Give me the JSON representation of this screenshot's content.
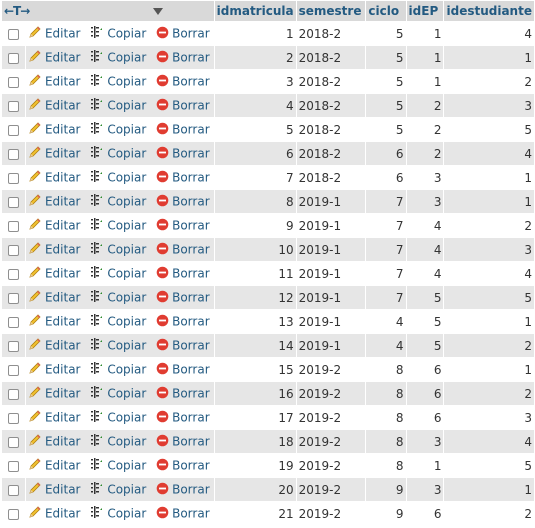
{
  "header": {
    "nav_arrows": "←T→",
    "columns": [
      "idmatricula",
      "semestre",
      "ciclo",
      "idEP",
      "idestudiante"
    ]
  },
  "actions": {
    "edit_label": "Editar",
    "copy_label": "Copiar",
    "delete_label": "Borrar"
  },
  "colors": {
    "link": "#235a81",
    "row_even": "#e6e6e6",
    "header_bg": "#d9d9d9",
    "delete_red": "#e03c31"
  },
  "icons": {
    "edit": "pencil-icon",
    "copy": "copy-icon",
    "delete": "delete-icon"
  },
  "rows": [
    {
      "idmatricula": "1",
      "semestre": "2018-2",
      "ciclo": "5",
      "idEP": "1",
      "idestudiante": "4"
    },
    {
      "idmatricula": "2",
      "semestre": "2018-2",
      "ciclo": "5",
      "idEP": "1",
      "idestudiante": "1"
    },
    {
      "idmatricula": "3",
      "semestre": "2018-2",
      "ciclo": "5",
      "idEP": "1",
      "idestudiante": "2"
    },
    {
      "idmatricula": "4",
      "semestre": "2018-2",
      "ciclo": "5",
      "idEP": "2",
      "idestudiante": "3"
    },
    {
      "idmatricula": "5",
      "semestre": "2018-2",
      "ciclo": "5",
      "idEP": "2",
      "idestudiante": "5"
    },
    {
      "idmatricula": "6",
      "semestre": "2018-2",
      "ciclo": "6",
      "idEP": "2",
      "idestudiante": "4"
    },
    {
      "idmatricula": "7",
      "semestre": "2018-2",
      "ciclo": "6",
      "idEP": "3",
      "idestudiante": "1"
    },
    {
      "idmatricula": "8",
      "semestre": "2019-1",
      "ciclo": "7",
      "idEP": "3",
      "idestudiante": "1"
    },
    {
      "idmatricula": "9",
      "semestre": "2019-1",
      "ciclo": "7",
      "idEP": "4",
      "idestudiante": "2"
    },
    {
      "idmatricula": "10",
      "semestre": "2019-1",
      "ciclo": "7",
      "idEP": "4",
      "idestudiante": "3"
    },
    {
      "idmatricula": "11",
      "semestre": "2019-1",
      "ciclo": "7",
      "idEP": "4",
      "idestudiante": "4"
    },
    {
      "idmatricula": "12",
      "semestre": "2019-1",
      "ciclo": "7",
      "idEP": "5",
      "idestudiante": "5"
    },
    {
      "idmatricula": "13",
      "semestre": "2019-1",
      "ciclo": "4",
      "idEP": "5",
      "idestudiante": "1"
    },
    {
      "idmatricula": "14",
      "semestre": "2019-1",
      "ciclo": "4",
      "idEP": "5",
      "idestudiante": "2"
    },
    {
      "idmatricula": "15",
      "semestre": "2019-2",
      "ciclo": "8",
      "idEP": "6",
      "idestudiante": "1"
    },
    {
      "idmatricula": "16",
      "semestre": "2019-2",
      "ciclo": "8",
      "idEP": "6",
      "idestudiante": "2"
    },
    {
      "idmatricula": "17",
      "semestre": "2019-2",
      "ciclo": "8",
      "idEP": "6",
      "idestudiante": "3"
    },
    {
      "idmatricula": "18",
      "semestre": "2019-2",
      "ciclo": "8",
      "idEP": "3",
      "idestudiante": "4"
    },
    {
      "idmatricula": "19",
      "semestre": "2019-2",
      "ciclo": "8",
      "idEP": "1",
      "idestudiante": "5"
    },
    {
      "idmatricula": "20",
      "semestre": "2019-2",
      "ciclo": "9",
      "idEP": "3",
      "idestudiante": "1"
    },
    {
      "idmatricula": "21",
      "semestre": "2019-2",
      "ciclo": "9",
      "idEP": "6",
      "idestudiante": "2"
    }
  ]
}
